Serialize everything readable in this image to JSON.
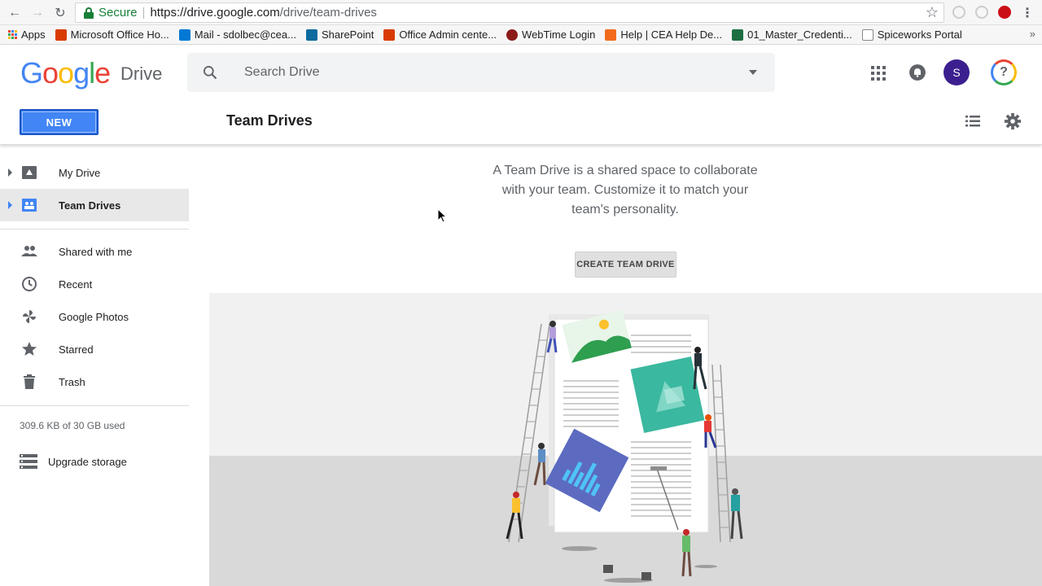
{
  "browser": {
    "secure_label": "Secure",
    "url_host": "https://drive.google.com",
    "url_path": "/drive/team-drives",
    "bookmarks": [
      {
        "label": "Apps",
        "color": "#5f6368"
      },
      {
        "label": "Microsoft Office Ho...",
        "color": "#d83b01"
      },
      {
        "label": "Mail - sdolbec@cea...",
        "color": "#0078d4"
      },
      {
        "label": "SharePoint",
        "color": "#0b6a9e"
      },
      {
        "label": "Office Admin cente...",
        "color": "#d83b01"
      },
      {
        "label": "WebTime Login",
        "color": "#8b1a1a"
      },
      {
        "label": "Help | CEA Help De...",
        "color": "#f26b1d"
      },
      {
        "label": "01_Master_Credenti...",
        "color": "#1d6f42"
      },
      {
        "label": "Spiceworks Portal",
        "color": "#888888"
      }
    ],
    "more": "»"
  },
  "header": {
    "logo": "Google",
    "product": "Drive",
    "search_placeholder": "Search Drive",
    "avatar_initial": "S",
    "help_label": "?"
  },
  "toolbar": {
    "new_label": "NEW",
    "page_title": "Team Drives"
  },
  "sidebar": {
    "items": [
      {
        "label": "My Drive",
        "icon": "my-drive-icon"
      },
      {
        "label": "Team Drives",
        "icon": "team-drives-icon"
      },
      {
        "label": "Shared with me",
        "icon": "people-icon"
      },
      {
        "label": "Recent",
        "icon": "clock-icon"
      },
      {
        "label": "Google Photos",
        "icon": "pinwheel-icon"
      },
      {
        "label": "Starred",
        "icon": "star-icon"
      },
      {
        "label": "Trash",
        "icon": "trash-icon"
      }
    ],
    "storage_text": "309.6 KB of 30 GB used",
    "upgrade_label": "Upgrade storage"
  },
  "main": {
    "intro_text": "A Team Drive is a shared space to collaborate with your team. Customize it to match your team's personality.",
    "create_label": "CREATE TEAM DRIVE"
  },
  "colors": {
    "accent": "#4285f4",
    "active_bg": "#e8e8e8"
  }
}
